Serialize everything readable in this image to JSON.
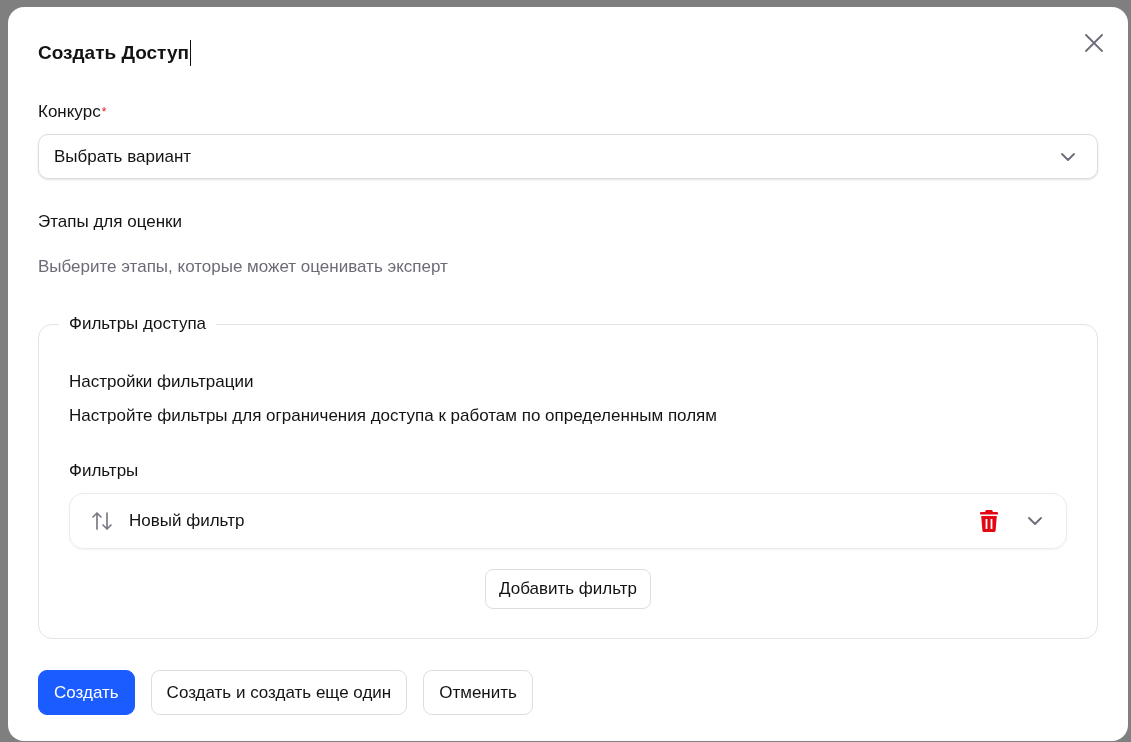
{
  "dialog": {
    "title": "Создать Доступ",
    "title_caret": true
  },
  "contest": {
    "label": "Конкурс",
    "required_mark": "*",
    "placeholder": "Выбрать вариант",
    "expanded": false
  },
  "stages": {
    "label": "Этапы для оценки",
    "hint": "Выберите этапы, которые может оценивать эксперт"
  },
  "access_filters": {
    "legend": "Фильтры доступа",
    "heading": "Настройки фильтрации",
    "description": "Настройте фильтры для ограничения доступа к работам по определенным полям",
    "filters_label": "Фильтры",
    "filters": [
      {
        "name": "Новый фильтр",
        "expanded": false
      }
    ],
    "add_button": "Добавить фильтр"
  },
  "buttons": [
    {
      "label": "Создать",
      "kind": "primary"
    },
    {
      "label": "Создать и создать еще один",
      "kind": "secondary"
    },
    {
      "label": "Отменить",
      "kind": "secondary"
    }
  ]
}
